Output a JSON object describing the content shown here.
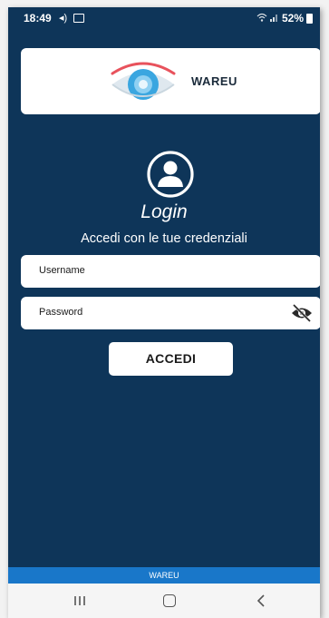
{
  "status_bar": {
    "time": "18:49",
    "volume_icon": "volume-icon",
    "image_icon": "image-icon",
    "wifi_icon": "wifi-icon",
    "signal_icon": "signal-icon",
    "battery": "52%",
    "battery_icon": "battery-icon"
  },
  "logo": {
    "name": "WAREU",
    "icon": "eye-logo-icon"
  },
  "login": {
    "user_icon": "user-circle-icon",
    "title": "Login",
    "subtitle": "Accedi con le tue credenziali"
  },
  "form": {
    "username_label": "Username",
    "password_label": "Password",
    "visibility_icon": "eye-off-icon",
    "submit_label": "ACCEDI"
  },
  "footer": {
    "label": "WAREU"
  },
  "nav_bar": {
    "recents_icon": "recents-icon",
    "home_icon": "home-icon",
    "back_icon": "back-icon"
  },
  "colors": {
    "background": "#0e3559",
    "footer": "#1977c9",
    "card": "#ffffff",
    "logo_arc": "#e8525c",
    "logo_iris": "#3aa6e0"
  }
}
